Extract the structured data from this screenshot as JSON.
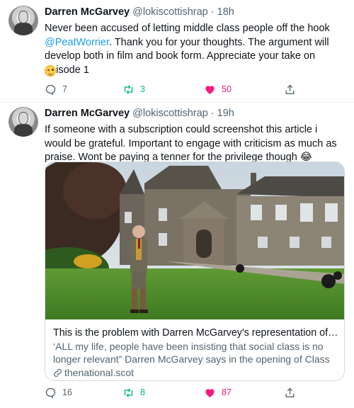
{
  "tweets": [
    {
      "name": "Darren McGarvey",
      "handle": "@lokiscottishrap",
      "separator": "·",
      "time": "18h",
      "text_pre": "Never been accused of letting middle class people off the hook ",
      "mention": "@PeatWorrier",
      "text_post": ". Thank you for your thoughts. The argument will develop both in film and book form. Appreciate your take on episode 1",
      "emoji_icon": "winking-face-emoji",
      "replies": "7",
      "retweets": "3",
      "likes": "50"
    },
    {
      "name": "Darren McGarvey",
      "handle": "@lokiscottishrap",
      "separator": "·",
      "time": "19h",
      "text": "If someone with a subscription could screenshot this article i would be grateful. Important to engage with criticism as much as praise. Wont be paying a tenner for the privilege though 😂",
      "card": {
        "title": "This is the problem with Darren McGarvey's representation of middl...",
        "description": "‘ALL my life, people have been insisting that social class is no longer relevant” Darren McGarvey says in the opening of Class Wars, a ...",
        "domain": "thenational.scot"
      },
      "replies": "16",
      "retweets": "8",
      "likes": "87"
    }
  ],
  "colors": {
    "accent": "#1d9bf0",
    "retweet": "#00ba7c",
    "like": "#f91880",
    "secondary_text": "#536471"
  }
}
